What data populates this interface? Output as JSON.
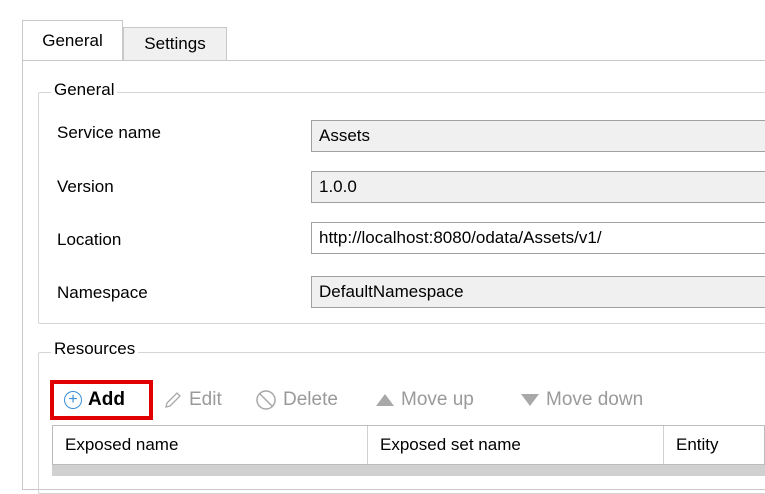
{
  "tabs": [
    {
      "label": "General",
      "active": true
    },
    {
      "label": "Settings",
      "active": false
    }
  ],
  "general": {
    "legend": "General",
    "fields": [
      {
        "label": "Service name",
        "value": "Assets",
        "editable": false
      },
      {
        "label": "Version",
        "value": "1.0.0",
        "editable": false
      },
      {
        "label": "Location",
        "value": "http://localhost:8080/odata/Assets/v1/",
        "editable": true
      },
      {
        "label": "Namespace",
        "value": "DefaultNamespace",
        "editable": false
      }
    ]
  },
  "resources": {
    "legend": "Resources",
    "toolbar": {
      "add": "Add",
      "edit": "Edit",
      "delete": "Delete",
      "move_up": "Move up",
      "move_down": "Move down"
    },
    "columns": [
      "Exposed name",
      "Exposed set name",
      "Entity"
    ]
  },
  "colors": {
    "highlight_border": "#e00000",
    "add_icon": "#3a8fd8",
    "disabled_text": "#9a9a9a"
  }
}
